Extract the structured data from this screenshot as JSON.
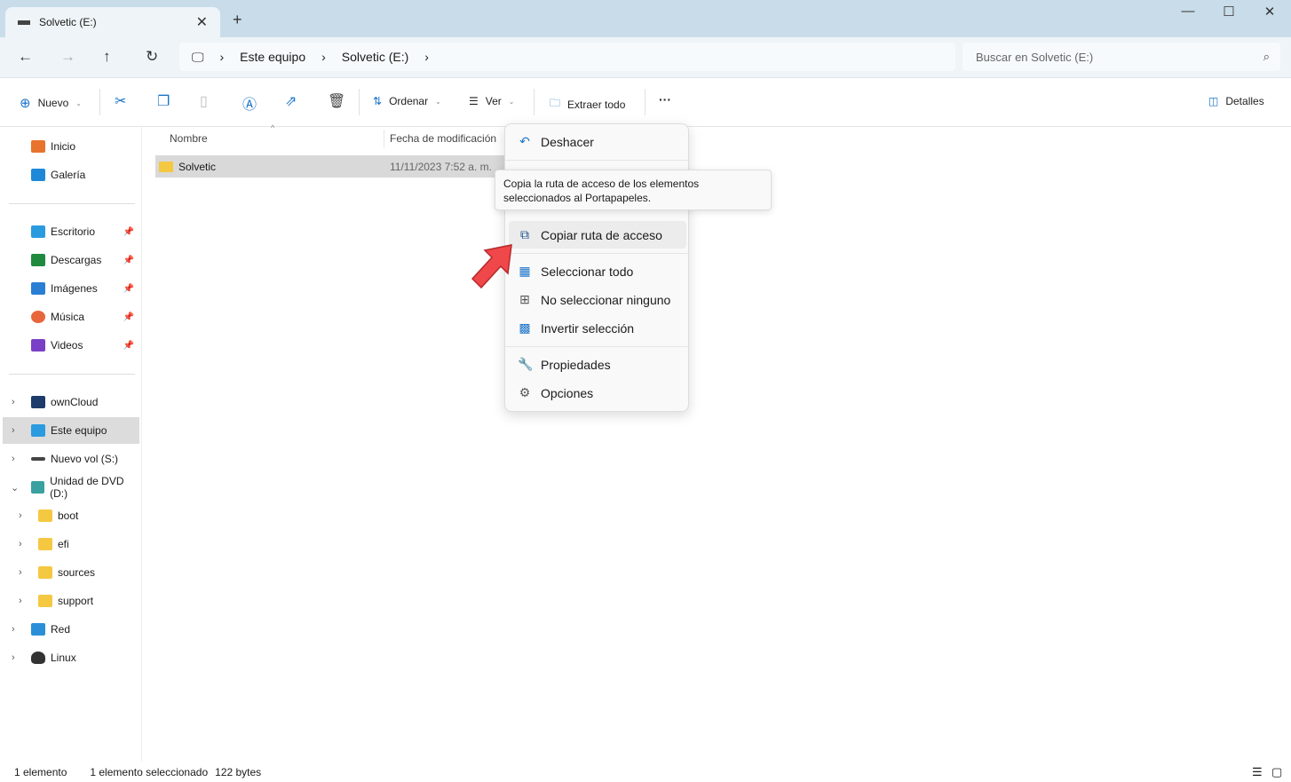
{
  "window": {
    "tab_title": "Solvetic (E:)",
    "new_tab": "+",
    "minimize": "—",
    "maximize": "☐",
    "close": "✕"
  },
  "nav": {
    "breadcrumb": [
      "Este equipo",
      "Solvetic (E:)"
    ],
    "search_placeholder": "Buscar en Solvetic (E:)"
  },
  "toolbar": {
    "new": "Nuevo",
    "sort": "Ordenar",
    "view": "Ver",
    "extract": "Extraer todo",
    "more": "···",
    "details": "Detalles"
  },
  "sidebar": {
    "quick": [
      {
        "label": "Inicio",
        "color": "#e8732c"
      },
      {
        "label": "Galería",
        "color": "#1e88d8"
      }
    ],
    "pinned": [
      {
        "label": "Escritorio",
        "color": "#2b9be0"
      },
      {
        "label": "Descargas",
        "color": "#1f8a3d"
      },
      {
        "label": "Imágenes",
        "color": "#2a7fd4"
      },
      {
        "label": "Música",
        "color": "#e8663c"
      },
      {
        "label": "Videos",
        "color": "#7a3fc7"
      }
    ],
    "tree": [
      {
        "label": "ownCloud"
      },
      {
        "label": "Este equipo"
      },
      {
        "label": "Nuevo vol (S:)"
      },
      {
        "label": "Unidad de DVD (D:)"
      },
      {
        "label": "boot"
      },
      {
        "label": "efi"
      },
      {
        "label": "sources"
      },
      {
        "label": "support"
      },
      {
        "label": "Red"
      },
      {
        "label": "Linux"
      }
    ]
  },
  "columns": {
    "name": "Nombre",
    "modified": "Fecha de modificación"
  },
  "files": [
    {
      "name": "Solvetic",
      "modified": "11/11/2023 7:52 a. m."
    }
  ],
  "menu": {
    "undo": "Deshacer",
    "copy_path": "Copiar ruta de acceso",
    "select_all": "Seleccionar todo",
    "select_none": "No seleccionar ninguno",
    "invert": "Invertir selección",
    "properties": "Propiedades",
    "options": "Opciones"
  },
  "tooltip": "Copia la ruta de acceso de los elementos seleccionados al Portapapeles.",
  "status": {
    "count": "1 elemento",
    "selected": "1 elemento seleccionado",
    "size": "122 bytes"
  }
}
